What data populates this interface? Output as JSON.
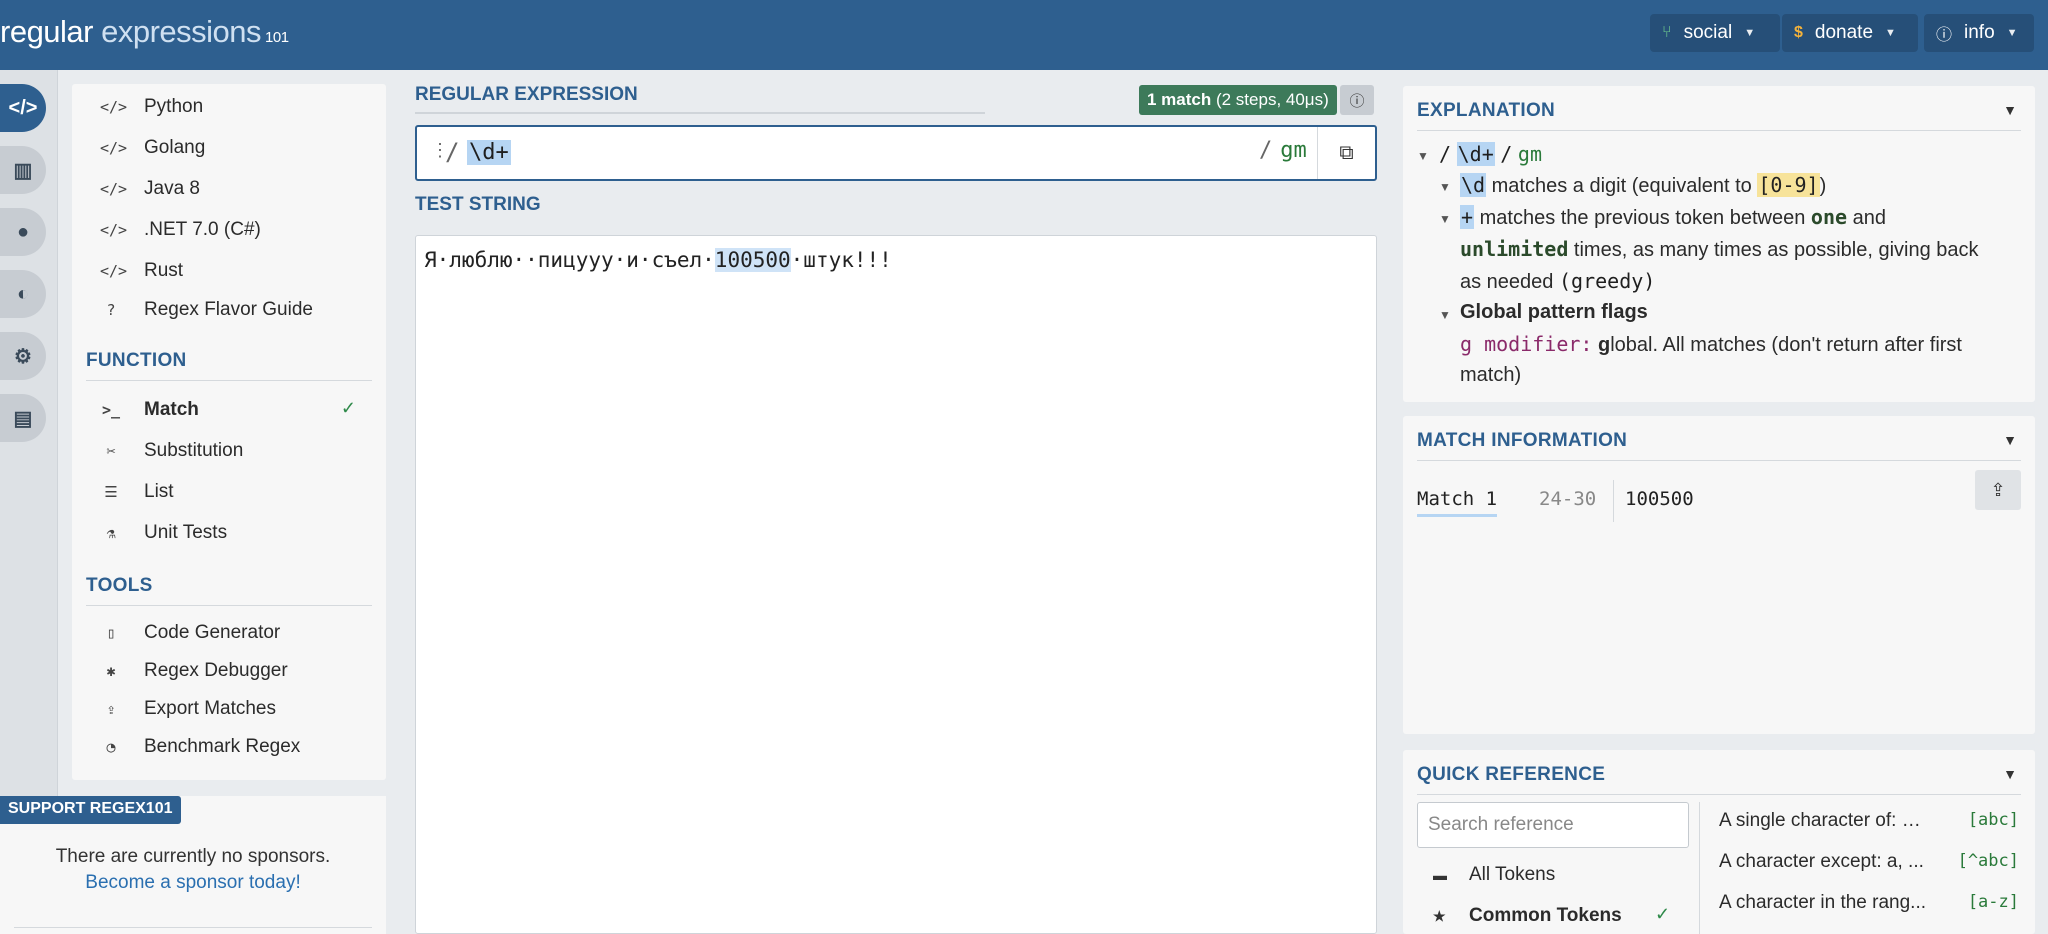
{
  "header": {
    "logo_regular": "regular",
    "logo_expressions": " expressions",
    "logo_version": "101",
    "social": "social",
    "donate": "donate",
    "info": "info"
  },
  "rail": [
    "code-icon",
    "library-icon",
    "user-icon",
    "gamepad-icon",
    "settings-icon",
    "chat-icon"
  ],
  "left": {
    "flavors": [
      "Python",
      "Golang",
      "Java 8",
      ".NET 7.0 (C#)",
      "Rust",
      "Regex Flavor Guide"
    ],
    "function_heading": "FUNCTION",
    "functions": [
      "Match",
      "Substitution",
      "List",
      "Unit Tests"
    ],
    "tools_heading": "TOOLS",
    "tools": [
      "Code Generator",
      "Regex Debugger",
      "Export Matches",
      "Benchmark Regex"
    ]
  },
  "support": {
    "tag": "SUPPORT REGEX101",
    "text": "There are currently no sponsors.",
    "link": "Become a sponsor today!"
  },
  "regex": {
    "label": "REGULAR EXPRESSION",
    "badge_count": "1 match",
    "badge_detail": " (2 steps, 40μs)",
    "delimiter": "/",
    "expression": "\\d+",
    "flags": "gm"
  },
  "test_string": {
    "label": "TEST STRING",
    "before": "Я·люблю··пицууу·и·съел·",
    "match": "100500",
    "after": "·штук!!!"
  },
  "explanation": {
    "heading": "EXPLANATION",
    "top_slash1": "/",
    "top_expr": "\\d+",
    "top_slash2": "/",
    "top_flags": "gm",
    "d_token": "\\d",
    "d_text1": " matches a digit (equivalent to ",
    "d_range": "[0-9]",
    "d_text2": ")",
    "plus_token": "+",
    "plus_text1": " matches the previous token between ",
    "plus_one": "one",
    "plus_text2": " and",
    "plus_unlimited": "unlimited",
    "plus_text3": " times, as many times as possible, giving back",
    "plus_text4": "as needed ",
    "plus_greedy": "(greedy)",
    "flags_title": "Global pattern flags",
    "g_mod": "g modifier:",
    "g_letter": "g",
    "g_text": "lobal. All matches (don't return after first",
    "g_text2": "match)"
  },
  "match_info": {
    "heading": "MATCH INFORMATION",
    "match_label": "Match 1",
    "range": "24-30",
    "value": "100500"
  },
  "quick_ref": {
    "heading": "QUICK REFERENCE",
    "search_placeholder": "Search reference",
    "categories": [
      "All Tokens",
      "Common Tokens"
    ],
    "rows": [
      {
        "desc": "A single character of: a,...",
        "token": "[abc]"
      },
      {
        "desc": "A character except: a, ...",
        "token": "[^abc]"
      },
      {
        "desc": "A character in the rang...",
        "token": "[a-z]"
      }
    ]
  },
  "colors": {
    "header": "#2e5f8f",
    "accent": "#2e5f8f",
    "match_badge": "#3d7a5a",
    "highlight": "#b6d5f3"
  }
}
